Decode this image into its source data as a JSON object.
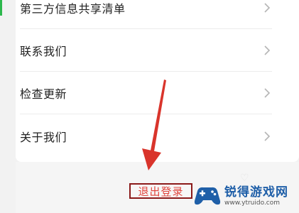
{
  "menu": {
    "items": [
      {
        "label": "第三方信息共享清单"
      },
      {
        "label": "联系我们"
      },
      {
        "label": "检查更新"
      },
      {
        "label": "关于我们"
      }
    ]
  },
  "logout": {
    "label": "退出登录"
  },
  "watermark": {
    "title": "锐得游戏网",
    "url": "www.ytruido.com"
  },
  "colors": {
    "accent_red": "#e0443c",
    "highlight_box": "#8b1a1a",
    "arrow_red": "#d9342b",
    "watermark_blue": "#1f5fa8"
  },
  "icons": {
    "chevron": "chevron-right-icon",
    "arrow": "annotation-arrow-icon",
    "logo": "gamepad-logo-icon"
  }
}
